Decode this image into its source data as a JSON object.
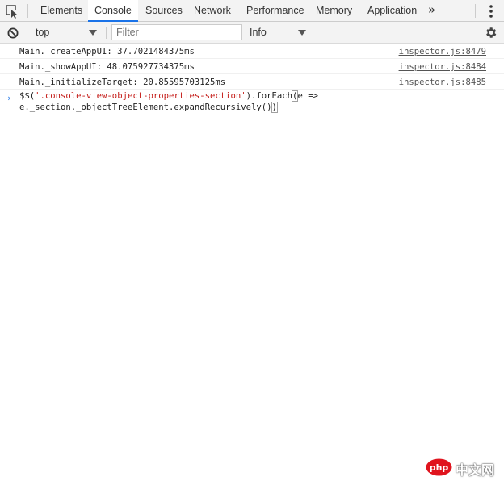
{
  "tabs": [
    {
      "label": "Elements",
      "active": false
    },
    {
      "label": "Console",
      "active": true
    },
    {
      "label": "Sources",
      "active": false
    },
    {
      "label": "Network",
      "active": false
    },
    {
      "label": "Performance",
      "active": false
    },
    {
      "label": "Memory",
      "active": false
    },
    {
      "label": "Application",
      "active": false
    }
  ],
  "icons": {
    "inspect": "inspect-element-icon",
    "more_tabs": "double-chevron-right-icon",
    "more_tabs_glyph": "»",
    "kebab": "vertical-dots-icon",
    "clear": "no-entry-icon",
    "settings": "gear-icon",
    "prompt": "chevron-right-icon"
  },
  "toolbar": {
    "context": "top",
    "filter_placeholder": "Filter",
    "filter_value": "",
    "level": "Info"
  },
  "messages": [
    {
      "text": "Main._createAppUI: 37.7021484375ms",
      "source": "inspector.js:8479"
    },
    {
      "text": "Main._showAppUI: 48.075927734375ms",
      "source": "inspector.js:8484"
    },
    {
      "text": "Main._initializeTarget: 20.85595703125ms",
      "source": "inspector.js:8485"
    }
  ],
  "prompt": {
    "chevron": "›",
    "line1_prefix": "$$(",
    "line1_string": "'.console-view-object-properties-section'",
    "line1_suffix": ").forEach",
    "line1_paren": "(",
    "line1_rest": "e =>",
    "line2_main": "e._section._objectTreeElement.expandRecursively()",
    "line2_close": ")"
  },
  "watermark": {
    "logo_text": "php",
    "text": "中文网"
  },
  "colors": {
    "accent": "#1a73e8",
    "string": "#c41a16",
    "toolbar_bg": "#f3f3f3"
  }
}
